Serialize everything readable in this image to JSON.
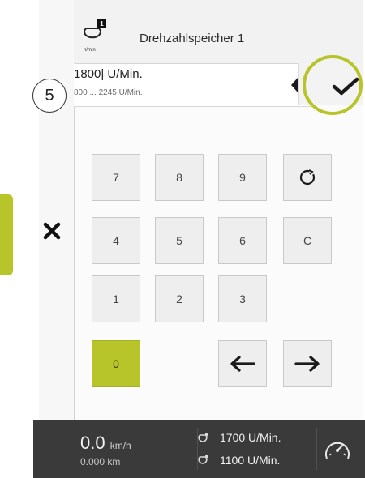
{
  "header": {
    "title": "Drehzahlspeicher 1",
    "icon": "engine-speed-memory-icon",
    "badge": "1",
    "icon_unit": "n/min"
  },
  "input": {
    "value": "1800| U/Min.",
    "range": "800 ... 2245 U/Min."
  },
  "step": "5",
  "keypad": {
    "keys": [
      "7",
      "8",
      "9",
      "4",
      "5",
      "6",
      "C",
      "1",
      "2",
      "3",
      "0"
    ],
    "special": {
      "cycle": "rotate-icon",
      "left": "arrow-left-icon",
      "right": "arrow-right-icon"
    }
  },
  "status": {
    "speed": "0.0",
    "speed_unit": "km/h",
    "distance": "0.000 km",
    "rpm1": "1700 U/Min.",
    "rpm2": "1100 U/Min."
  },
  "colors": {
    "accent": "#b7c42a",
    "statusbar": "#3a3a3a",
    "key": "#eeeeee"
  }
}
